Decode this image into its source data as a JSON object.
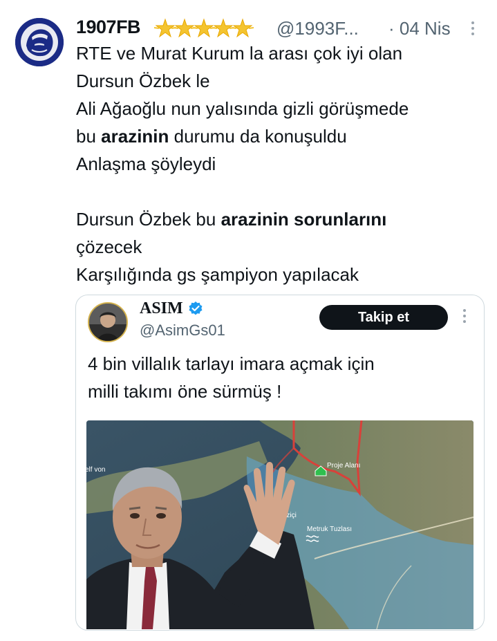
{
  "tweet": {
    "display_name": "1907FB",
    "name_emoji": [
      "star-emoji",
      "star-emoji",
      "star-emoji",
      "star-emoji",
      "star-emoji"
    ],
    "handle": "@1993F...",
    "date": "· 04 Nis",
    "lines": [
      {
        "pre": "RTE ve Murat Kurum la arası çok iyi olan",
        "bold": "",
        "post": ""
      },
      {
        "pre": "Dursun Özbek le",
        "bold": "",
        "post": ""
      },
      {
        "pre": "Ali Ağaoğlu nun yalısında gizli görüşmede",
        "bold": "",
        "post": ""
      },
      {
        "pre": "bu ",
        "bold": "arazinin",
        "post": " durumu da konuşuldu"
      },
      {
        "pre": "Anlaşma şöyleydi",
        "bold": "",
        "post": ""
      },
      {
        "pre": "",
        "bold": "",
        "post": ""
      },
      {
        "pre": "Dursun Özbek bu ",
        "bold": "arazinin sorunlarını",
        "post": ""
      },
      {
        "pre": "çözecek",
        "bold": "",
        "post": ""
      },
      {
        "pre": "Karşılığında gs şampiyon yapılacak",
        "bold": "",
        "post": ""
      }
    ]
  },
  "quote": {
    "display_name": "ASIM",
    "handle": "@AsimGs01",
    "follow_label": "Takip et",
    "text_lines": [
      "4 bin villalık tarlayı imara açmak için",
      "milli takımı öne sürmüş !"
    ],
    "map_labels": {
      "project": "Proje Alanı",
      "bogazici": "Boğaziçi",
      "tuzla": "Metruk Tuzlası",
      "edge": "elf von"
    }
  },
  "colors": {
    "text": "#0f1419",
    "secondary": "#536471",
    "verified": "#1d9bf0",
    "follow_bg": "#0f1419",
    "border": "#cfd9de"
  },
  "icons": {
    "more": "more-vertical-icon",
    "verified": "verified-badge-icon",
    "star": "star-emoji"
  }
}
